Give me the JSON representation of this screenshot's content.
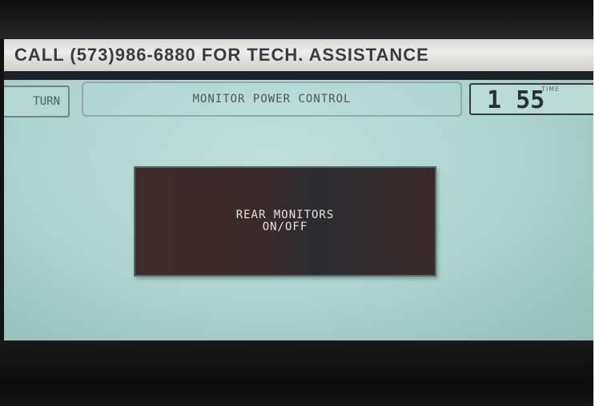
{
  "banner": {
    "text": "CALL (573)986-6880 FOR TECH. ASSISTANCE"
  },
  "header": {
    "return_label": "TURN",
    "title": "MONITOR POWER CONTROL",
    "time_label": "TIME",
    "time_value": "1 55"
  },
  "main": {
    "rear_button": {
      "line1": "REAR MONITORS",
      "line2": "ON/OFF"
    }
  },
  "colors": {
    "screen": "#acd3ce",
    "button": "#3a2a2b",
    "banner": "#e6e6e2"
  }
}
